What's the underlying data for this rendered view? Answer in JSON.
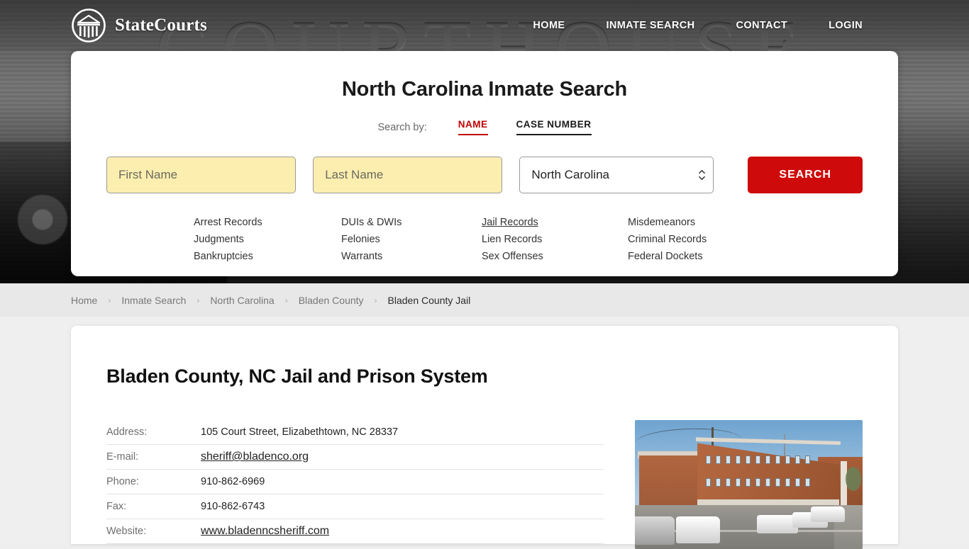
{
  "brand": {
    "name": "StateCourts",
    "logo_icon": "courthouse-circle-logo"
  },
  "nav": [
    {
      "label": "HOME"
    },
    {
      "label": "INMATE SEARCH"
    },
    {
      "label": "CONTACT"
    },
    {
      "label": "LOGIN"
    }
  ],
  "hero": {
    "background_word": "COURTHOUSE"
  },
  "search": {
    "title": "North Carolina Inmate Search",
    "search_by_label": "Search by:",
    "tabs": [
      {
        "label": "NAME",
        "active": true
      },
      {
        "label": "CASE NUMBER",
        "active": false
      }
    ],
    "first_name": {
      "value": "",
      "placeholder": "First Name"
    },
    "last_name": {
      "value": "",
      "placeholder": "Last Name"
    },
    "state_select": {
      "value": "North Carolina",
      "icon": "stepper-arrows-icon"
    },
    "submit_label": "SEARCH",
    "accent_red": "#cf0a0a",
    "autofill_yellow": "#fceeaf"
  },
  "quick_links": [
    {
      "label": "Arrest Records",
      "hovered": false
    },
    {
      "label": "DUIs & DWIs",
      "hovered": false
    },
    {
      "label": "Jail Records",
      "hovered": true
    },
    {
      "label": "Misdemeanors",
      "hovered": false
    },
    {
      "label": "Judgments",
      "hovered": false
    },
    {
      "label": "Felonies",
      "hovered": false
    },
    {
      "label": "Lien Records",
      "hovered": false
    },
    {
      "label": "Criminal Records",
      "hovered": false
    },
    {
      "label": "Bankruptcies",
      "hovered": false
    },
    {
      "label": "Warrants",
      "hovered": false
    },
    {
      "label": "Sex Offenses",
      "hovered": false
    },
    {
      "label": "Federal Dockets",
      "hovered": false
    }
  ],
  "breadcrumb": {
    "separator": "›",
    "items": [
      {
        "label": "Home",
        "current": false
      },
      {
        "label": "Inmate Search",
        "current": false
      },
      {
        "label": "North Carolina",
        "current": false
      },
      {
        "label": "Bladen County",
        "current": false
      },
      {
        "label": "Bladen County Jail",
        "current": true
      }
    ]
  },
  "main": {
    "title": "Bladen County, NC Jail and Prison System",
    "info_rows": [
      {
        "label": "Address:",
        "value": "105 Court Street, Elizabethtown, NC 28337",
        "link": false
      },
      {
        "label": "E-mail:",
        "value": "sheriff@bladenco.org",
        "link": true
      },
      {
        "label": "Phone:",
        "value": "910-862-6969",
        "link": false
      },
      {
        "label": "Fax:",
        "value": "910-862-6743",
        "link": false
      },
      {
        "label": "Website:",
        "value": "www.bladenncsheriff.com",
        "link": true
      }
    ],
    "photo_alt": "bladen-county-jail-building-photo"
  }
}
